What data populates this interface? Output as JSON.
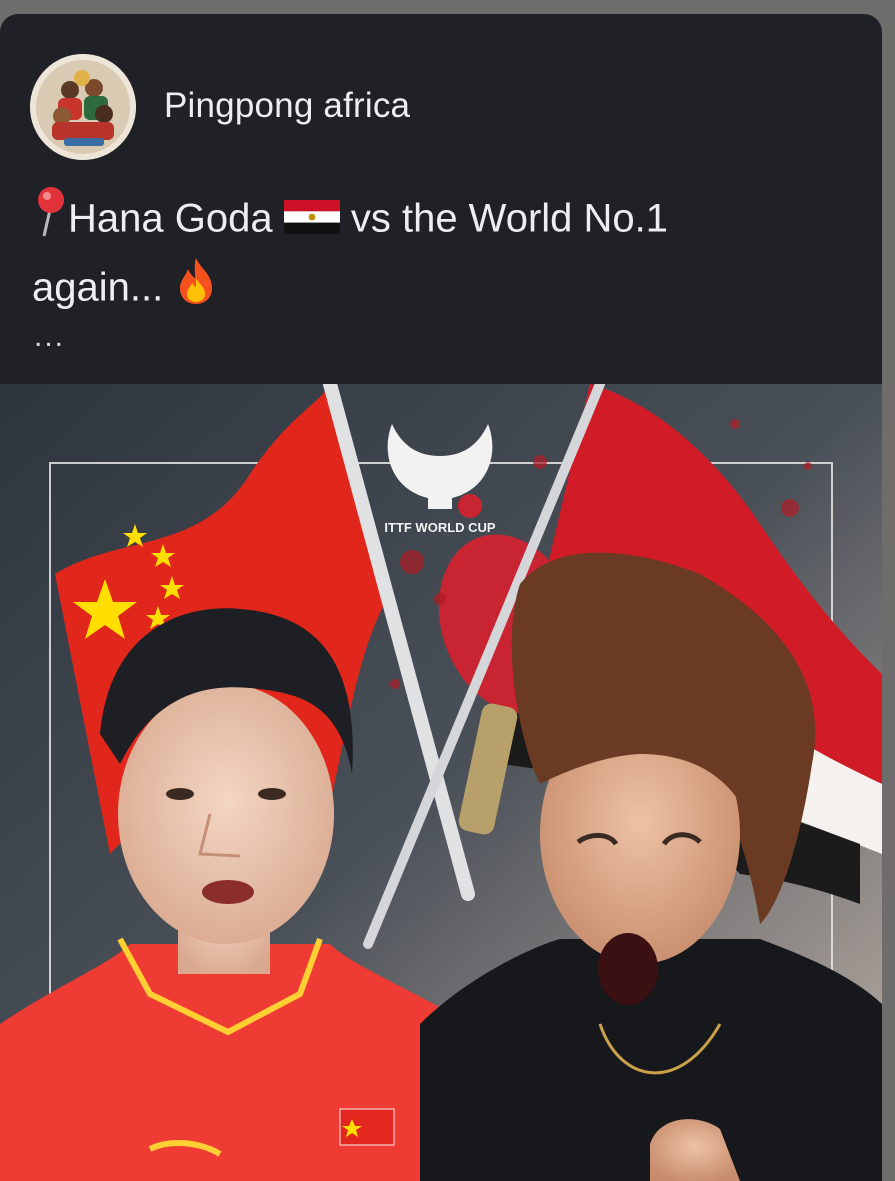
{
  "post": {
    "page_name": "Pingpong africa",
    "text_line1_name": "Hana Goda",
    "text_line1_rest": "vs the World No.1",
    "text_line2": "again...",
    "more_label": "...",
    "icons": [
      "round-pushpin-icon",
      "egypt-flag-icon",
      "fire-icon"
    ]
  },
  "media": {
    "logo_text": "ITTF WORLD CUP",
    "colors": {
      "china_red": "#e1261c",
      "china_star": "#ffde00",
      "egypt_red": "#ce1126",
      "egypt_white": "#ffffff",
      "egypt_black": "#000000",
      "background": "#3a3f47"
    }
  }
}
